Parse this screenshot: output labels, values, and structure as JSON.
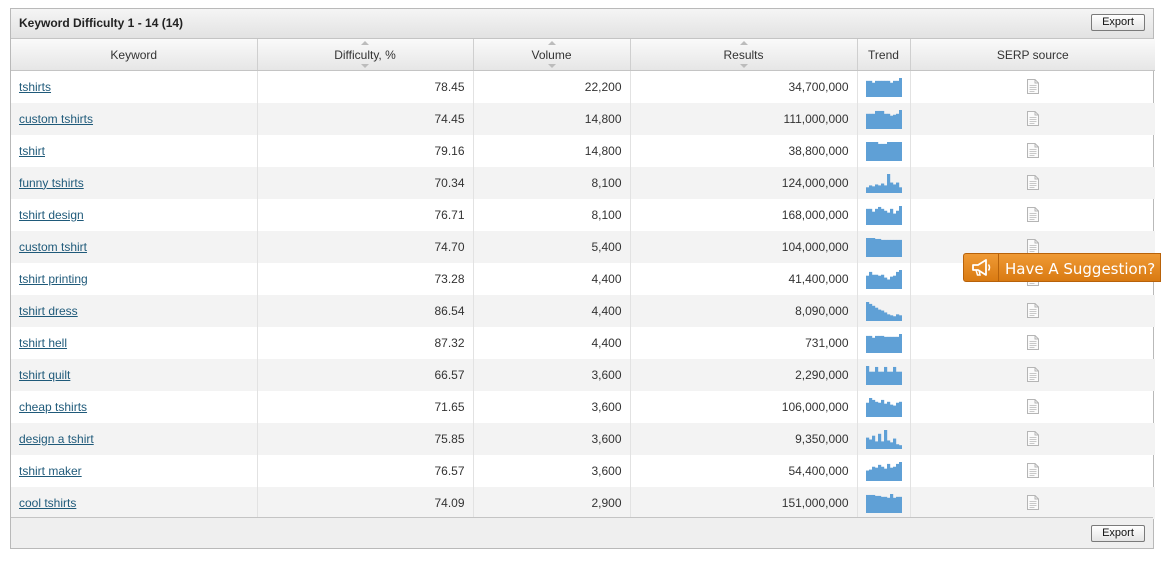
{
  "panel": {
    "title": "Keyword Difficulty 1 - 14 (14)",
    "export_label": "Export"
  },
  "table": {
    "headers": [
      "Keyword",
      "Difficulty, %",
      "Volume",
      "Results",
      "Trend",
      "SERP source"
    ],
    "rows": [
      {
        "keyword": "tshirts",
        "difficulty": "78.45",
        "volume": "22,200",
        "results": "34,700,000",
        "trend": [
          0.85,
          0.85,
          0.75,
          0.85,
          0.85,
          0.85,
          0.85,
          0.85,
          0.75,
          0.85,
          0.85,
          1.0
        ]
      },
      {
        "keyword": "custom tshirts",
        "difficulty": "74.45",
        "volume": "14,800",
        "results": "111,000,000",
        "trend": [
          0.8,
          0.8,
          0.8,
          0.95,
          0.95,
          0.95,
          0.8,
          0.8,
          0.7,
          0.75,
          0.8,
          1.0
        ]
      },
      {
        "keyword": "tshirt",
        "difficulty": "79.16",
        "volume": "14,800",
        "results": "38,800,000",
        "trend": [
          1.0,
          1.0,
          1.0,
          1.0,
          0.9,
          0.9,
          0.9,
          1.0,
          1.0,
          1.0,
          1.0,
          1.0
        ]
      },
      {
        "keyword": "funny tshirts",
        "difficulty": "70.34",
        "volume": "8,100",
        "results": "124,000,000",
        "trend": [
          0.3,
          0.4,
          0.35,
          0.45,
          0.4,
          0.5,
          0.4,
          1.0,
          0.55,
          0.45,
          0.55,
          0.3
        ]
      },
      {
        "keyword": "tshirt design",
        "difficulty": "76.71",
        "volume": "8,100",
        "results": "168,000,000",
        "trend": [
          0.85,
          0.85,
          0.7,
          0.85,
          0.95,
          0.85,
          0.75,
          0.65,
          0.85,
          0.6,
          0.75,
          1.0
        ]
      },
      {
        "keyword": "custom tshirt",
        "difficulty": "74.70",
        "volume": "5,400",
        "results": "104,000,000",
        "trend": [
          1.0,
          1.0,
          1.0,
          0.95,
          0.95,
          0.9,
          0.9,
          0.9,
          0.9,
          0.9,
          0.9,
          0.9
        ]
      },
      {
        "keyword": "tshirt printing",
        "difficulty": "73.28",
        "volume": "4,400",
        "results": "41,400,000",
        "trend": [
          0.7,
          0.9,
          0.75,
          0.75,
          0.7,
          0.75,
          0.6,
          0.5,
          0.65,
          0.7,
          0.9,
          1.0
        ]
      },
      {
        "keyword": "tshirt dress",
        "difficulty": "86.54",
        "volume": "4,400",
        "results": "8,090,000",
        "trend": [
          1.0,
          0.9,
          0.8,
          0.7,
          0.6,
          0.55,
          0.45,
          0.35,
          0.3,
          0.25,
          0.35,
          0.3
        ]
      },
      {
        "keyword": "tshirt hell",
        "difficulty": "87.32",
        "volume": "4,400",
        "results": "731,000",
        "trend": [
          0.9,
          0.9,
          0.8,
          0.9,
          0.9,
          0.9,
          0.85,
          0.85,
          0.85,
          0.85,
          0.85,
          1.0
        ]
      },
      {
        "keyword": "tshirt quilt",
        "difficulty": "66.57",
        "volume": "3,600",
        "results": "2,290,000",
        "trend": [
          1.0,
          0.7,
          0.7,
          0.95,
          0.7,
          0.7,
          0.95,
          0.7,
          0.7,
          0.95,
          0.7,
          0.7
        ]
      },
      {
        "keyword": "cheap tshirts",
        "difficulty": "71.65",
        "volume": "3,600",
        "results": "106,000,000",
        "trend": [
          0.75,
          1.0,
          0.9,
          0.8,
          0.75,
          0.9,
          0.7,
          0.8,
          0.65,
          0.6,
          0.75,
          0.8
        ]
      },
      {
        "keyword": "design a tshirt",
        "difficulty": "75.85",
        "volume": "3,600",
        "results": "9,350,000",
        "trend": [
          0.6,
          0.5,
          0.7,
          0.4,
          0.8,
          0.4,
          1.0,
          0.45,
          0.35,
          0.55,
          0.25,
          0.2
        ]
      },
      {
        "keyword": "tshirt maker",
        "difficulty": "76.57",
        "volume": "3,600",
        "results": "54,400,000",
        "trend": [
          0.55,
          0.6,
          0.75,
          0.7,
          0.85,
          0.75,
          0.65,
          0.9,
          0.7,
          0.75,
          0.9,
          1.0
        ]
      },
      {
        "keyword": "cool tshirts",
        "difficulty": "74.09",
        "volume": "2,900",
        "results": "151,000,000",
        "trend": [
          0.95,
          0.95,
          0.95,
          0.9,
          0.9,
          0.85,
          0.85,
          0.8,
          1.0,
          0.8,
          0.85,
          0.85
        ]
      }
    ]
  },
  "suggestion": {
    "label": "Have A Suggestion?",
    "icon": "megaphone-icon"
  },
  "colors": {
    "trend_bar": "#5fa0d6",
    "suggestion_bg": "#e38a20",
    "link": "#1f5a7a"
  }
}
